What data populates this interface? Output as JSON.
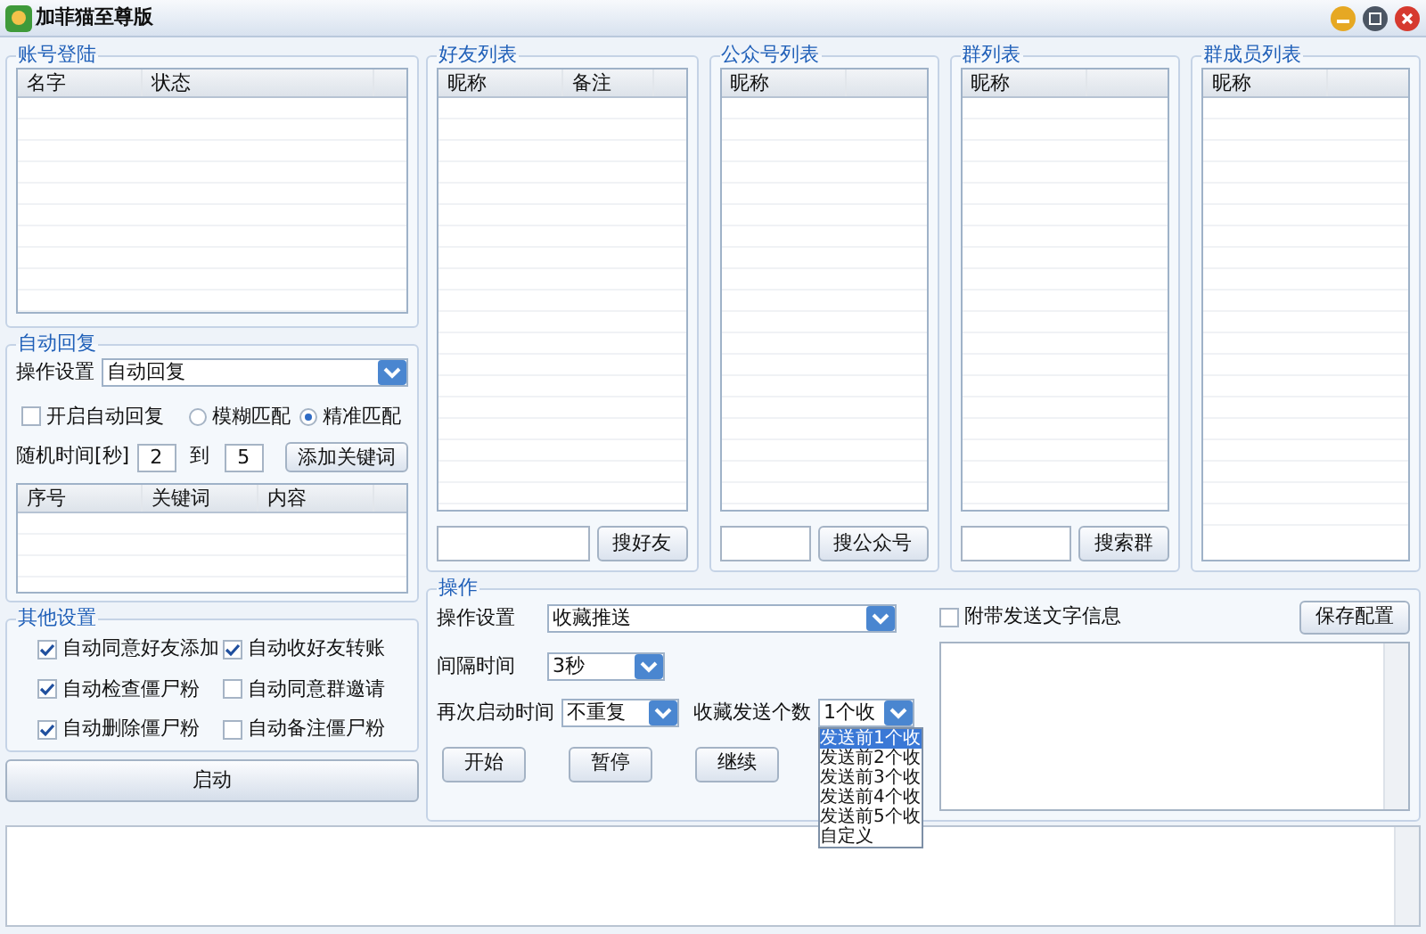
{
  "window": {
    "title": "加菲猫至尊版"
  },
  "account_panel": {
    "title": "账号登陆",
    "columns": [
      "名字",
      "状态"
    ]
  },
  "auto_reply": {
    "title": "自动回复",
    "setting_label": "操作设置",
    "setting_value": "自动回复",
    "enable": {
      "label": "开启自动回复",
      "checked": false
    },
    "match_modes": [
      {
        "label": "模糊匹配",
        "selected": false
      },
      {
        "label": "精准匹配",
        "selected": true
      }
    ],
    "random_time_label": "随机时间[秒]",
    "from": "2",
    "to_label": "到",
    "to": "5",
    "add_button": "添加关键词",
    "columns": [
      "序号",
      "关键词",
      "内容"
    ]
  },
  "other_settings": {
    "title": "其他设置",
    "options": [
      {
        "label": "自动同意好友添加",
        "checked": true
      },
      {
        "label": "自动收好友转账",
        "checked": true
      },
      {
        "label": "自动检查僵尸粉",
        "checked": true
      },
      {
        "label": "自动同意群邀请",
        "checked": false
      },
      {
        "label": "自动删除僵尸粉",
        "checked": true
      },
      {
        "label": "自动备注僵尸粉",
        "checked": false
      }
    ]
  },
  "start_button": "启动",
  "lists": [
    {
      "title": "好友列表",
      "columns": [
        "昵称",
        "备注"
      ],
      "search_button": "搜好友"
    },
    {
      "title": "公众号列表",
      "columns": [
        "昵称"
      ],
      "search_button": "搜公众号"
    },
    {
      "title": "群列表",
      "columns": [
        "昵称"
      ],
      "search_button": "搜索群"
    },
    {
      "title": "群成员列表",
      "columns": [
        "昵称"
      ]
    }
  ],
  "operation": {
    "title": "操作",
    "setting_label": "操作设置",
    "setting_value": "收藏推送",
    "interval_label": "间隔时间",
    "interval_value": "3秒",
    "restart_label": "再次启动时间",
    "restart_value": "不重复",
    "count_label": "收藏发送个数",
    "count_value": "1个收",
    "count_options": [
      {
        "label": "发送前1个收",
        "selected": true
      },
      {
        "label": "发送前2个收",
        "selected": false
      },
      {
        "label": "发送前3个收",
        "selected": false
      },
      {
        "label": "发送前4个收",
        "selected": false
      },
      {
        "label": "发送前5个收",
        "selected": false
      },
      {
        "label": "自定义",
        "selected": false
      }
    ],
    "buttons": [
      "开始",
      "暂停",
      "继续"
    ],
    "attach_text": {
      "label": "附带发送文字信息",
      "checked": false
    },
    "save_button": "保存配置"
  }
}
